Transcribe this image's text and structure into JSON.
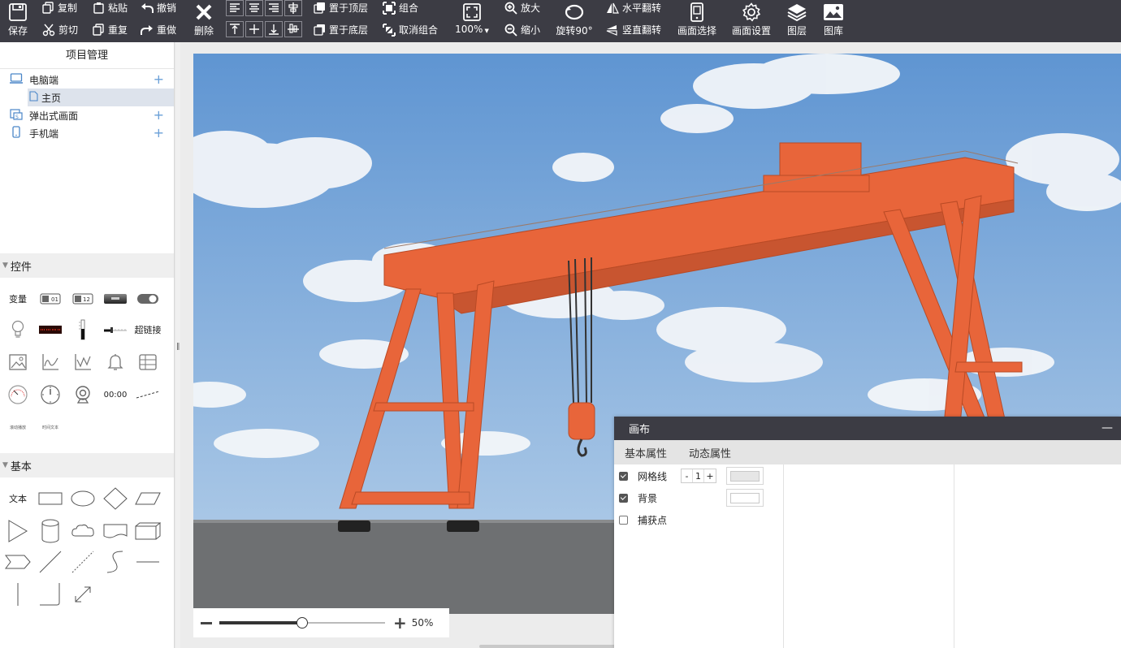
{
  "toolbar": {
    "save": "保存",
    "copy": "复制",
    "paste": "粘贴",
    "undo": "撤销",
    "cut": "剪切",
    "duplicate": "重复",
    "redo": "重做",
    "delete": "删除",
    "bring_top": "置于顶层",
    "send_bottom": "置于底层",
    "group": "组合",
    "ungroup": "取消组合",
    "fit_zoom": "100%",
    "zoom_in": "放大",
    "zoom_out": "缩小",
    "rotate": "旋转90°",
    "flip_h": "水平翻转",
    "flip_v": "竖直翻转",
    "screen_select": "画面选择",
    "screen_settings": "画面设置",
    "layers": "图层",
    "gallery": "图库"
  },
  "project": {
    "title": "项目管理",
    "items": [
      {
        "label": "电脑端",
        "icon": "monitor-icon",
        "has_add": true
      },
      {
        "label": "主页",
        "icon": "page-icon",
        "has_add": false,
        "selected": true
      },
      {
        "label": "弹出式画面",
        "icon": "popup-icon",
        "has_add": true
      },
      {
        "label": "手机端",
        "icon": "phone-icon",
        "has_add": true
      }
    ]
  },
  "controls": {
    "title": "控件",
    "variable": "变量",
    "hyperlink": "超链接",
    "clock": "00:00",
    "tiny1": "滚动播放",
    "tiny2": "时间文本",
    "switch_text": "01",
    "num_text": "12"
  },
  "basic": {
    "title": "基本",
    "text": "文本"
  },
  "zoom": {
    "value_label": "50%",
    "value": 0.5
  },
  "panel": {
    "title": "画布",
    "tabs": [
      "基本属性",
      "动态属性"
    ],
    "grid_label": "网格线",
    "grid_checked": true,
    "grid_size": "1",
    "minus": "-",
    "plus": "+",
    "bg_label": "背景",
    "bg_checked": true,
    "snap_label": "捕获点",
    "snap_checked": false,
    "grid_color": "#e6e6e6",
    "bg_color": "#ffffff"
  },
  "colors": {
    "toolbar_bg": "#3c3c44",
    "crane": "#e8653a",
    "sky": "#6d9fd6",
    "ground": "#6e7072"
  }
}
